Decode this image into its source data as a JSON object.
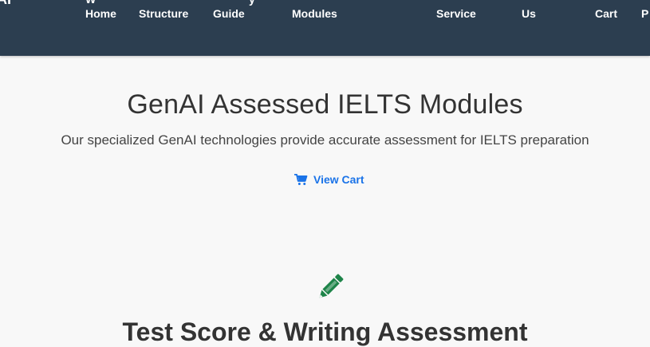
{
  "nav": {
    "brand_fragment": "AI",
    "items": [
      {
        "top": "W",
        "label": "Home"
      },
      {
        "top": "",
        "label": "Structure"
      },
      {
        "top": "y",
        "label": "Guide"
      },
      {
        "top": "",
        "label": "Modules"
      },
      {
        "top": "",
        "label": "Service"
      },
      {
        "top": "",
        "label": "Us"
      },
      {
        "top": "",
        "label": "Cart"
      },
      {
        "top": "",
        "label": "P"
      }
    ]
  },
  "hero": {
    "title": "GenAI Assessed IELTS Modules",
    "subtitle": "Our specialized GenAI technologies provide accurate assessment for IELTS preparation",
    "cart_link": {
      "icon": "cart-icon",
      "label": "View Cart"
    }
  },
  "section": {
    "icon": "pencil-icon",
    "heading": "Test Score & Writing Assessment"
  },
  "colors": {
    "navbar": "#2c3e50",
    "link": "#1a73e8",
    "icon_green": "#1e8449",
    "text_dark": "#333333"
  }
}
